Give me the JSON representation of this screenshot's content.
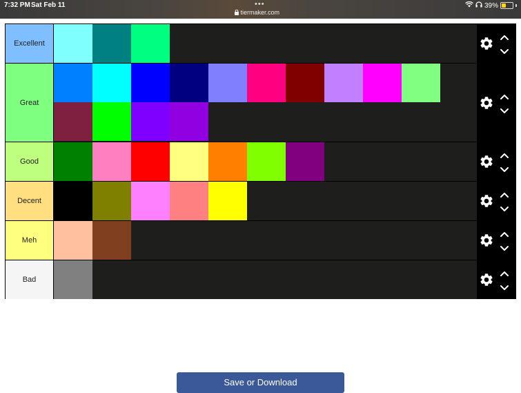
{
  "statusbar": {
    "time": "7:32 PM",
    "date": "Sat Feb 11",
    "dots": "•••",
    "url": "tiermaker.com",
    "battery": "39%",
    "battery_level": 0.39,
    "icons": [
      "lock-icon",
      "wifi-icon",
      "headphones-icon",
      "battery-icon"
    ]
  },
  "tiers": [
    {
      "label": "Excellent",
      "color": "#7fbfff",
      "items": [
        "#80ffff",
        "#008080",
        "#00ff80"
      ]
    },
    {
      "label": "Great",
      "color": "#7fff7f",
      "items": [
        "#0080ff",
        "#00ffff",
        "#0000ff",
        "#000080",
        "#8080ff",
        "#ff0080",
        "#800000",
        "#c080ff",
        "#ff00ff",
        "#80ff80",
        "#802040",
        "#00ff00",
        "#8000ff",
        "#9000e0"
      ]
    },
    {
      "label": "Good",
      "color": "#bfff7f",
      "items": [
        "#008000",
        "#ff80c0",
        "#ff0000",
        "#ffff80",
        "#ff8000",
        "#80ff00",
        "#800080"
      ]
    },
    {
      "label": "Decent",
      "color": "#ffdf80",
      "items": [
        "#000000",
        "#808000",
        "#ff80ff",
        "#ff8080",
        "#ffff00"
      ]
    },
    {
      "label": "Meh",
      "color": "#ffff7f",
      "items": [
        "#ffc0a0",
        "#804020"
      ]
    },
    {
      "label": "Bad",
      "color": "#f5f5f5",
      "items": [
        "#808080"
      ]
    }
  ],
  "save_button": "Save or Download"
}
